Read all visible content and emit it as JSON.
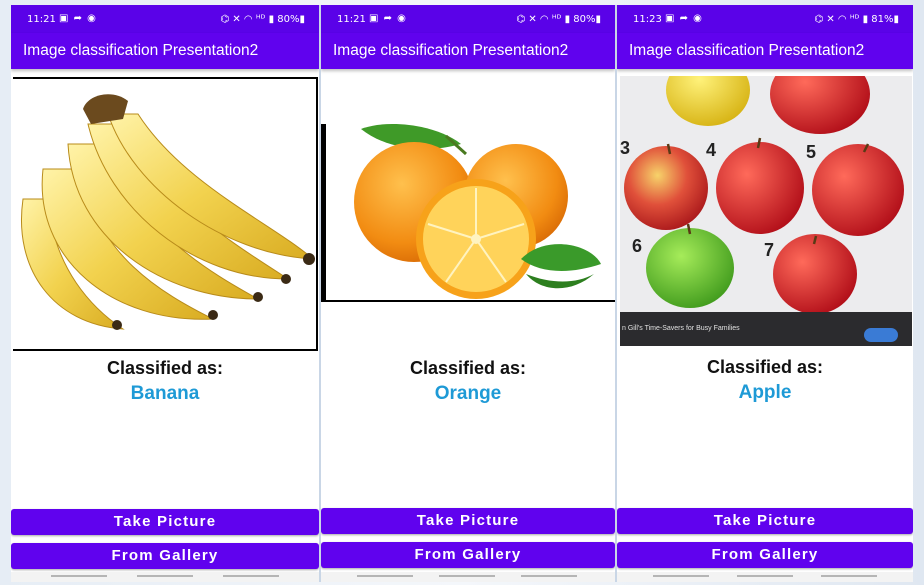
{
  "screens": [
    {
      "status_time": "11:21",
      "status_icons_left": "▣ ➦ ◉",
      "status_right": "⌬ ✕ ◠ ᴴᴰ ▮ 80%▮",
      "title": "Image classification Presentation2",
      "classified_label": "Classified as:",
      "classified_value": "Banana",
      "take_picture": "Take Picture",
      "from_gallery": "From Gallery",
      "image_subject": "banana-bunch-image"
    },
    {
      "status_time": "11:21",
      "status_icons_left": "▣ ➦ ◉",
      "status_right": "⌬ ✕ ◠ ᴴᴰ ▮ 80%▮",
      "title": "Image classification Presentation2",
      "classified_label": "Classified as:",
      "classified_value": "Orange",
      "take_picture": "Take Picture",
      "from_gallery": "From Gallery",
      "image_subject": "oranges-image"
    },
    {
      "status_time": "11:23",
      "status_icons_left": "▣ ➦ ◉",
      "status_right": "⌬ ✕ ◠ ᴴᴰ ▮ 81%▮",
      "title": "Image classification Presentation2",
      "classified_label": "Classified as:",
      "classified_value": "Apple",
      "take_picture": "Take Picture",
      "from_gallery": "From Gallery",
      "image_subject": "apples-on-screen-image",
      "image_numbers": [
        "3",
        "4",
        "5",
        "6",
        "7"
      ],
      "image_caption": "n Gill's Time-Savers for Busy Families"
    }
  ],
  "colors": {
    "app_bar": "#6002ee",
    "status_bar": "#5a02e8",
    "result_text": "#1e9ad6",
    "button": "#6002ee"
  }
}
